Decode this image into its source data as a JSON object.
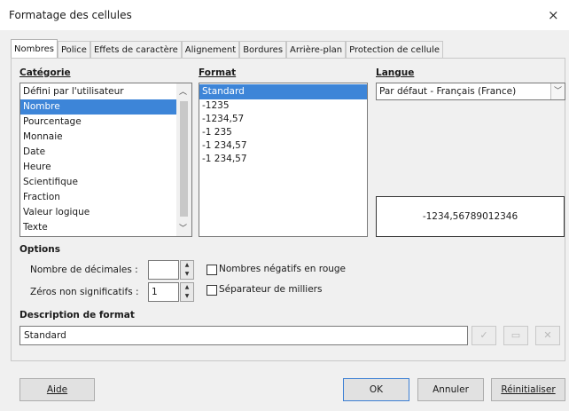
{
  "window": {
    "title": "Formatage des cellules",
    "close_glyph": "×"
  },
  "tabs": [
    {
      "label": "Nombres"
    },
    {
      "label": "Police"
    },
    {
      "label": "Effets de caractère"
    },
    {
      "label": "Alignement"
    },
    {
      "label": "Bordures"
    },
    {
      "label": "Arrière-plan"
    },
    {
      "label": "Protection de cellule"
    }
  ],
  "category": {
    "heading": "Catégorie",
    "items": [
      "Défini par l'utilisateur",
      "Nombre",
      "Pourcentage",
      "Monnaie",
      "Date",
      "Heure",
      "Scientifique",
      "Fraction",
      "Valeur logique",
      "Texte"
    ],
    "selected": "Nombre"
  },
  "format": {
    "heading": "Format",
    "items": [
      "Standard",
      "-1235",
      "-1234,57",
      "-1 235",
      "-1 234,57",
      "-1 234,57"
    ],
    "selected": "Standard"
  },
  "language": {
    "heading": "Langue",
    "value": "Par défaut - Français (France)"
  },
  "preview": {
    "text": "-1234,56789012346"
  },
  "options": {
    "heading": "Options",
    "decimals_label": "Nombre de décimales :",
    "decimals_value": "",
    "leading_zeros_label": "Zéros non significatifs :",
    "leading_zeros_value": "1",
    "negative_red_label": "Nombres négatifs en rouge",
    "thousands_sep_label": "Séparateur de milliers"
  },
  "format_code": {
    "heading": "Description de format",
    "value": "Standard"
  },
  "buttons": {
    "help": "Aide",
    "ok": "OK",
    "cancel": "Annuler",
    "reset": "Réinitialiser"
  },
  "icons": {
    "accept": "check-icon",
    "edit_comment": "comment-icon",
    "delete": "delete-icon"
  }
}
